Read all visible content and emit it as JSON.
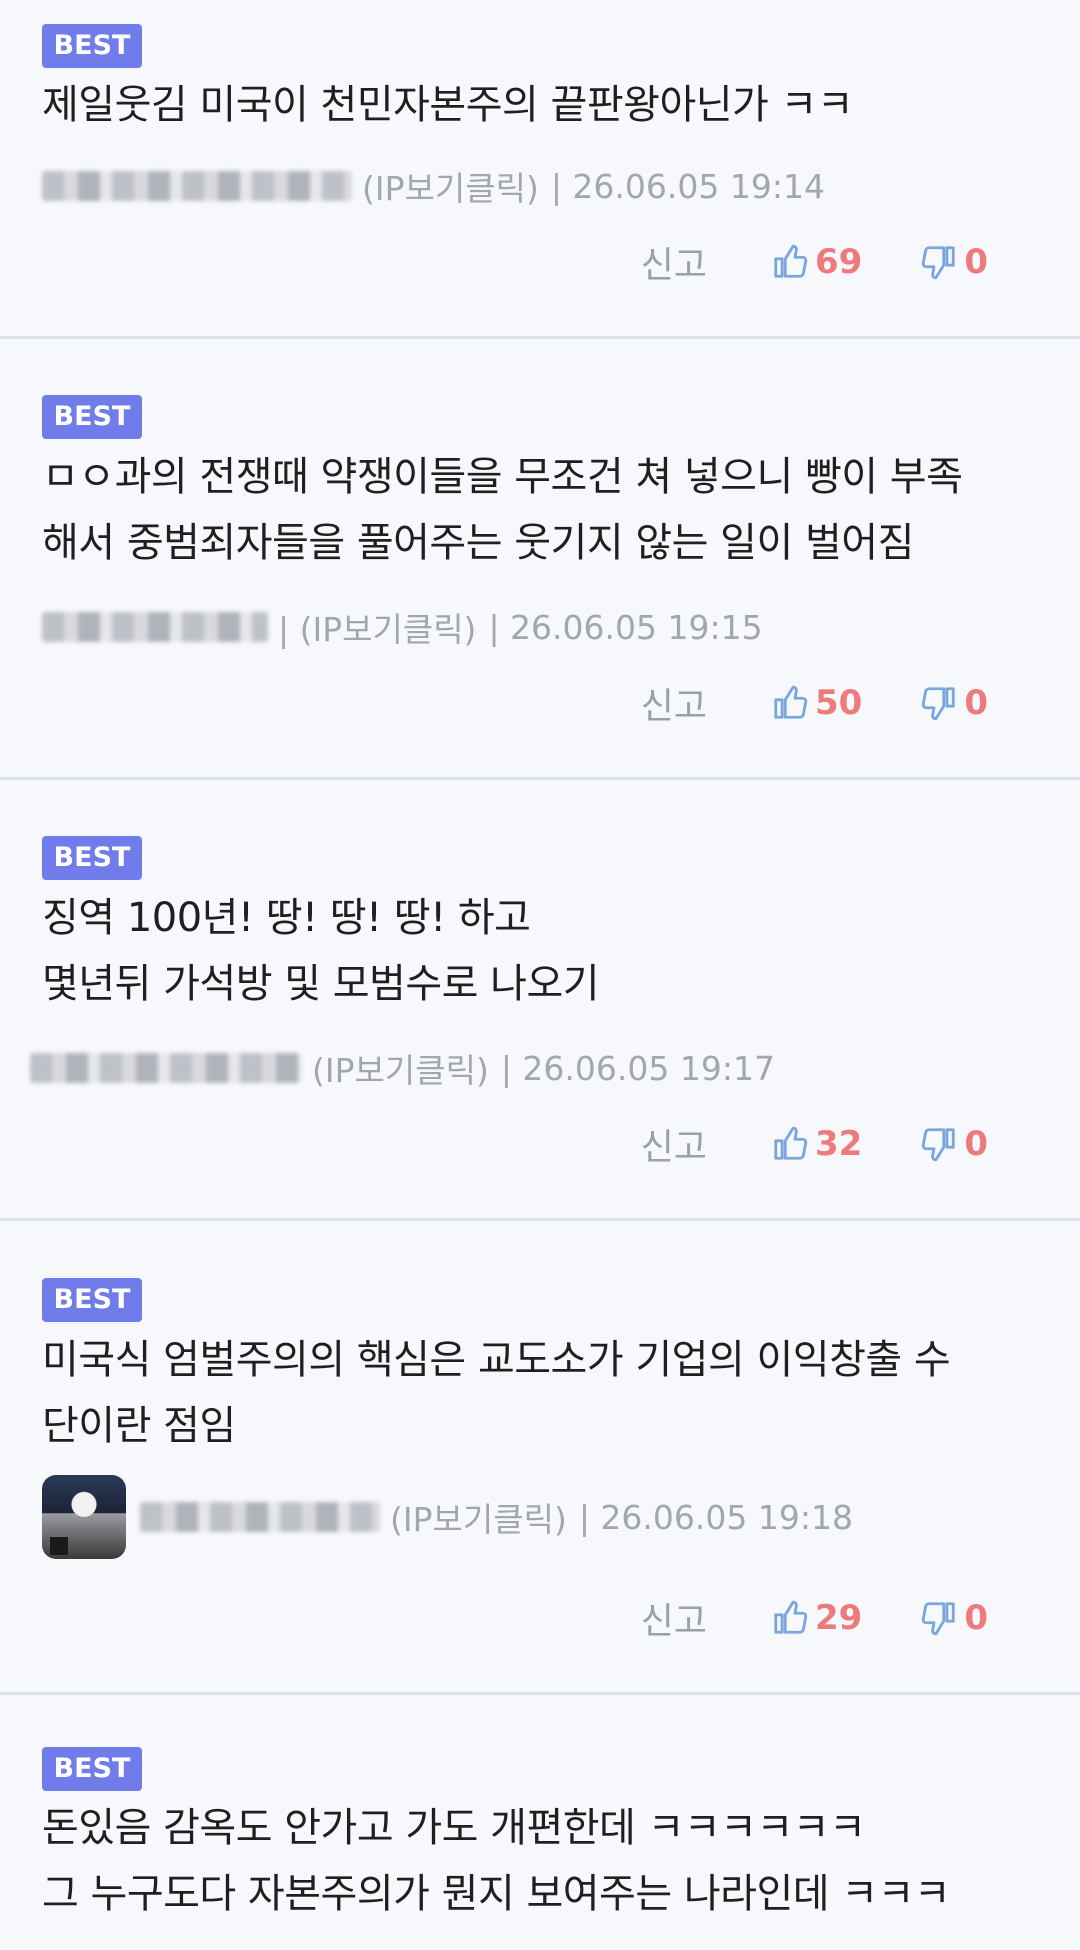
{
  "comments": [
    {
      "badge": "BEST",
      "text": "제일웃김 미국이 천민자본주의 끝판왕아닌가 ㅋㅋ",
      "ip": "(IP보기클릭)",
      "date": "| 26.06.05 19:14",
      "report": "신고",
      "likes": "69",
      "dislikes": "0"
    },
    {
      "badge": "BEST",
      "text": "ㅁㅇ과의 전쟁때 약쟁이들을 무조건 쳐 넣으니 빵이 부족\n해서 중범죄자들을 풀어주는 웃기지 않는 일이 벌어짐",
      "ip": "| (IP보기클릭)",
      "date": "| 26.06.05 19:15",
      "report": "신고",
      "likes": "50",
      "dislikes": "0"
    },
    {
      "badge": "BEST",
      "text": "징역 100년! 땅! 땅! 땅! 하고\n몇년뒤 가석방 및 모범수로 나오기",
      "ip": "(IP보기클릭)",
      "date": "| 26.06.05 19:17",
      "report": "신고",
      "likes": "32",
      "dislikes": "0"
    },
    {
      "badge": "BEST",
      "text": "미국식 엄벌주의의 핵심은 교도소가 기업의 이익창출 수\n단이란 점임",
      "ip": "(IP보기클릭)",
      "date": "| 26.06.05 19:18",
      "report": "신고",
      "likes": "29",
      "dislikes": "0"
    },
    {
      "badge": "BEST",
      "text": "돈있음 감옥도 안가고 가도 개편한데 ㅋㅋㅋㅋㅋㅋ\n그 누구도다 자본주의가 뭔지 보여주는 나라인데 ㅋㅋㅋ"
    }
  ],
  "colors": {
    "badge": "#6f7cea",
    "vote_count": "#ee7b7b",
    "vote_icon": "#7aa6dd",
    "meta": "#a2a6ad"
  }
}
